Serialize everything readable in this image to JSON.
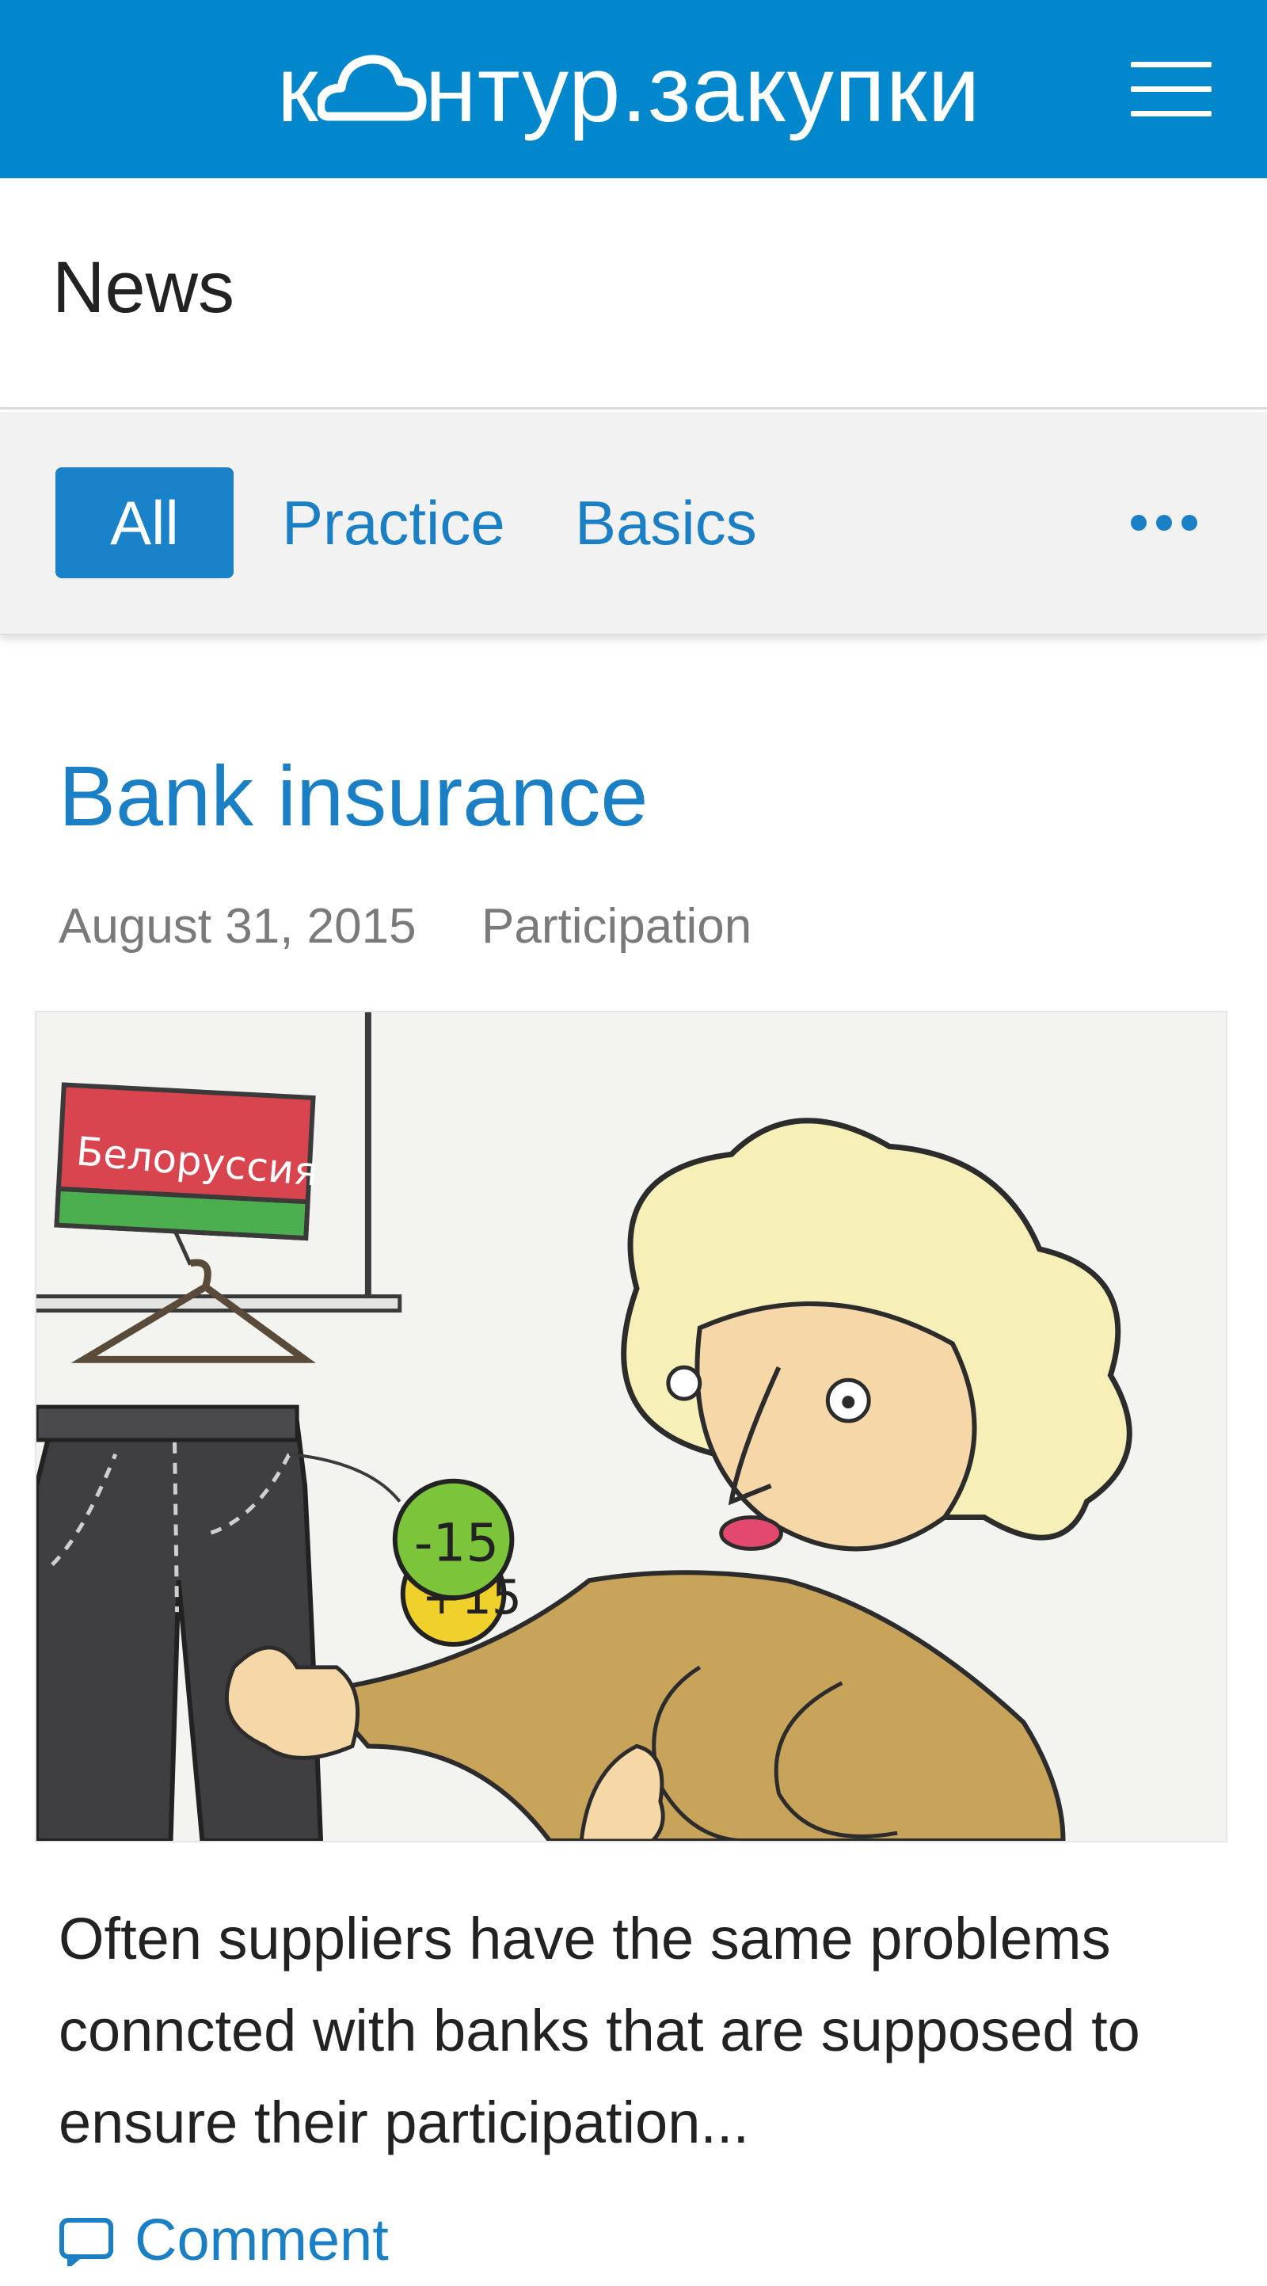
{
  "header": {
    "logo_prefix": "к",
    "logo_suffix": "нтур.закупки",
    "brand_color": "#0286cc",
    "menu_icon": "hamburger-menu-icon"
  },
  "page": {
    "title": "News"
  },
  "tabs": {
    "items": [
      {
        "label": "All",
        "active": true
      },
      {
        "label": "Practice",
        "active": false
      },
      {
        "label": "Basics",
        "active": false
      }
    ],
    "more_icon": "more-dots-icon"
  },
  "article": {
    "title": "Bank insurance",
    "date": "August 31, 2015",
    "category": "Participation",
    "image": {
      "sign_text": "Белоруссия",
      "tag_minus": "-15",
      "tag_plus": "+15"
    },
    "excerpt": "Often suppliers have the same problems conncted with banks that are supposed to ensure their participation...",
    "comment_label": "Comment",
    "comment_icon": "comment-bubble-icon"
  },
  "colors": {
    "link": "#1a7fc4",
    "active_tab_bg": "#1a82c8",
    "tabs_bg": "#f2f2f2"
  }
}
